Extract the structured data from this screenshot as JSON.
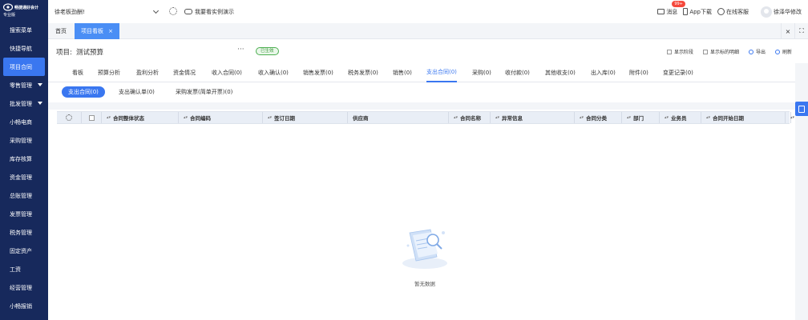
{
  "brand": {
    "name": "畅捷通好会计",
    "edition": "专业版"
  },
  "sidebar": {
    "items": [
      {
        "label": "搜索菜单",
        "caret": false,
        "active": false
      },
      {
        "label": "快捷导航",
        "caret": false,
        "active": false
      },
      {
        "label": "项目合同",
        "caret": false,
        "active": true
      },
      {
        "label": "零售管理",
        "caret": true,
        "active": false
      },
      {
        "label": "批发管理",
        "caret": true,
        "active": false
      },
      {
        "label": "小畅电商",
        "caret": false,
        "active": false
      },
      {
        "label": "采购管理",
        "caret": false,
        "active": false
      },
      {
        "label": "库存核算",
        "caret": false,
        "active": false
      },
      {
        "label": "资金管理",
        "caret": false,
        "active": false
      },
      {
        "label": "总账管理",
        "caret": false,
        "active": false
      },
      {
        "label": "发票管理",
        "caret": false,
        "active": false
      },
      {
        "label": "税务管理",
        "caret": false,
        "active": false
      },
      {
        "label": "固定资产",
        "caret": false,
        "active": false
      },
      {
        "label": "工资",
        "caret": false,
        "active": false
      },
      {
        "label": "经营管理",
        "caret": false,
        "active": false
      },
      {
        "label": "小畅报销",
        "caret": false,
        "active": false
      }
    ]
  },
  "topbar": {
    "company": "徐老板劲酬!",
    "demo": "我要看实例演示",
    "message": "消息",
    "message_badge": "99+",
    "app_download": "App下载",
    "online_service": "在线客服",
    "user": "徐泽华修改"
  },
  "tabs": {
    "home": "首页",
    "active": "项目看板",
    "close": "×"
  },
  "tabbar_right": {
    "close": "×",
    "expand": "⛶"
  },
  "project": {
    "label": "项目:",
    "name": "测试预算",
    "more": "···",
    "status": "已生效",
    "options": {
      "show_stage": "显示阶段",
      "show_marker": "显示标的明细",
      "export": "导出",
      "refresh": "刷新"
    }
  },
  "module_tabs": [
    {
      "label": "看板",
      "active": false
    },
    {
      "label": "预算分析",
      "active": false
    },
    {
      "label": "盈利分析",
      "active": false
    },
    {
      "label": "资金情况",
      "active": false
    },
    {
      "label": "收入合同(0)",
      "active": false
    },
    {
      "label": "收入确认(0)",
      "active": false
    },
    {
      "label": "销售发票(0)",
      "active": false
    },
    {
      "label": "税务发票(0)",
      "active": false
    },
    {
      "label": "销售(0)",
      "active": false
    },
    {
      "label": "支出合同(0)",
      "active": true
    },
    {
      "label": "采购(0)",
      "active": false
    },
    {
      "label": "收付款(0)",
      "active": false
    },
    {
      "label": "其他收支(0)",
      "active": false
    },
    {
      "label": "出入库(0)",
      "active": false
    },
    {
      "label": "附件(0)",
      "active": false
    },
    {
      "label": "变更记录(0)",
      "active": false
    }
  ],
  "sub_tabs": [
    {
      "label": "支出合同(0)",
      "active": true
    },
    {
      "label": "支出确认单(0)",
      "active": false
    },
    {
      "label": "采购发票(简单开票)(0)",
      "active": false
    }
  ],
  "table": {
    "columns": [
      {
        "label": "",
        "type": "gear"
      },
      {
        "label": "",
        "type": "checkbox"
      },
      {
        "label": "合同整体状态",
        "sortable": true
      },
      {
        "label": "合同编码",
        "sortable": true
      },
      {
        "label": "签订日期",
        "sortable": true
      },
      {
        "label": "供应商",
        "sortable": false
      },
      {
        "label": "合同名称",
        "sortable": true
      },
      {
        "label": "异常信息",
        "sortable": true
      },
      {
        "label": "合同分类",
        "sortable": true
      },
      {
        "label": "部门",
        "sortable": true
      },
      {
        "label": "业务员",
        "sortable": true
      },
      {
        "label": "合同开始日期",
        "sortable": true
      },
      {
        "label": "",
        "sortable": true
      }
    ],
    "rows": [],
    "empty_text": "暂无数据"
  },
  "colors": {
    "sidebar_bg": "#17295c",
    "accent": "#3a77f0",
    "tab_active": "#4a8ef5",
    "status_green": "#4caf50",
    "badge_red": "#f5483b"
  }
}
